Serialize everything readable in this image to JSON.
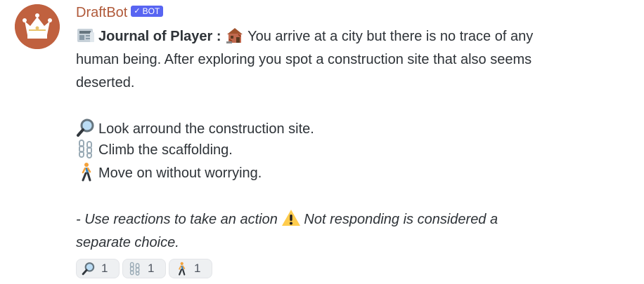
{
  "author": {
    "name": "DraftBot",
    "avatar_icon": "crown-icon",
    "avatar_color": "#c0613f",
    "name_color": "#b05a3a"
  },
  "bot_tag": {
    "label": "BOT",
    "check_glyph": "✓",
    "color": "#5865f2"
  },
  "message": {
    "journal_icon": "newspaper-icon",
    "journal_label": "Journal of Player :",
    "place_icon": "derelict-house-icon",
    "story_line1": "You arrive at a city but there is no trace of any",
    "story_line2": "human being. After exploring you spot a construction site that also seems",
    "story_line3": "deserted.",
    "choices": [
      {
        "icon": "magnifying-glass-icon",
        "text": "Look arround the construction site."
      },
      {
        "icon": "chains-icon",
        "text": "Climb the scaffolding."
      },
      {
        "icon": "person-walking-icon",
        "text": "Move on without worrying."
      }
    ],
    "hint_line1_part1": "- Use reactions to take an action",
    "warning_icon": "warning-icon",
    "hint_line1_part2": "Not responding is considered a",
    "hint_line2": "separate choice."
  },
  "reactions": [
    {
      "icon": "magnifying-glass-icon",
      "count": "1"
    },
    {
      "icon": "chains-icon",
      "count": "1"
    },
    {
      "icon": "person-walking-icon",
      "count": "1"
    }
  ]
}
